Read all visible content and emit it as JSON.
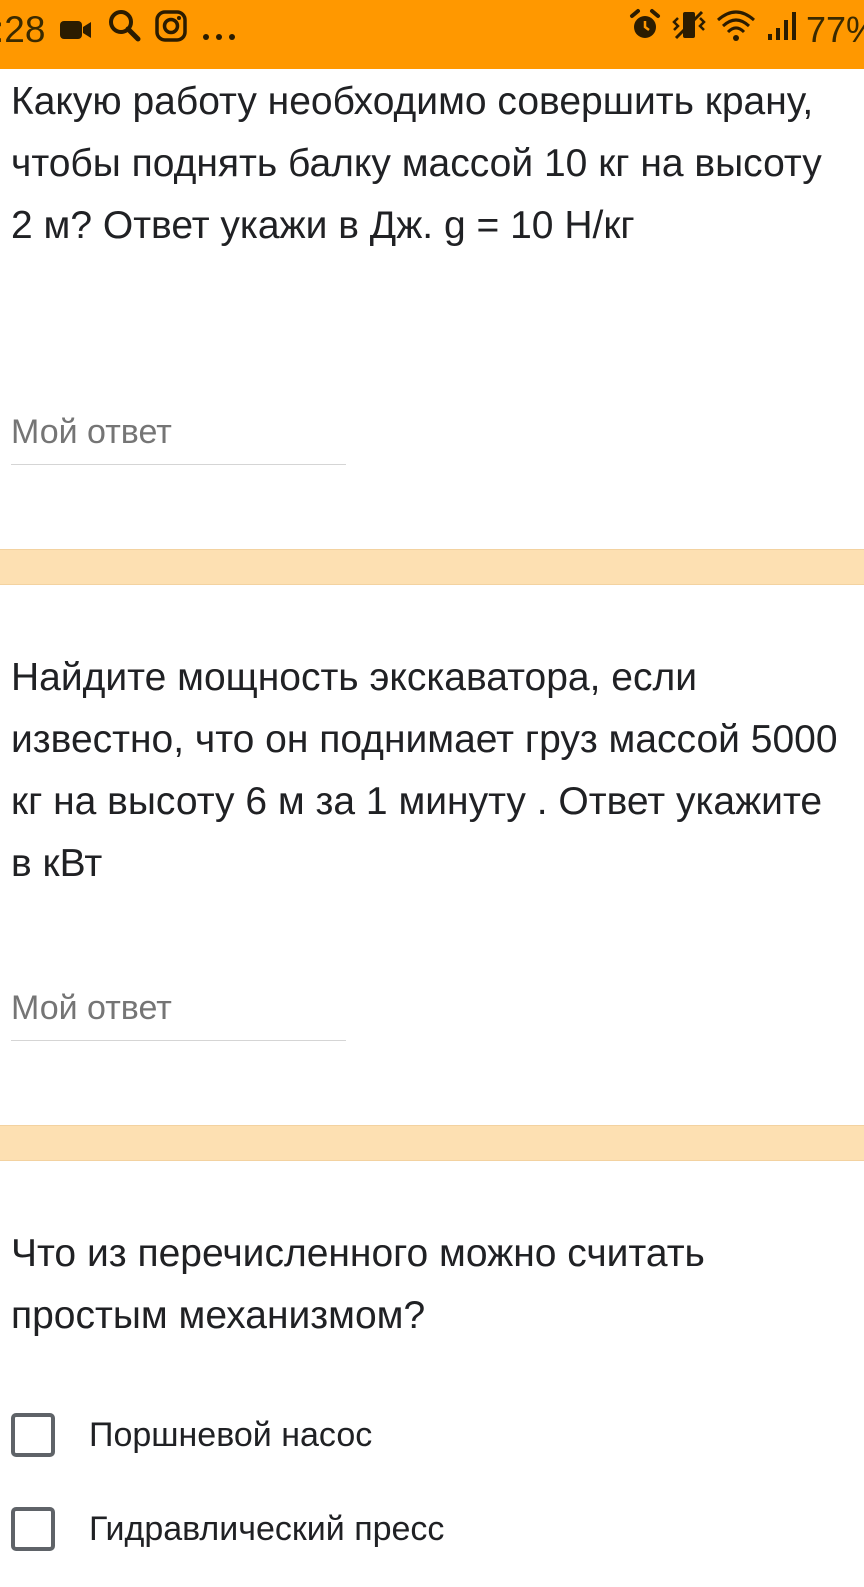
{
  "status_bar": {
    "time": ":28",
    "battery": "77%",
    "background_color": "#ff9800",
    "left_icons": [
      "video-icon",
      "search-icon",
      "instagram-icon",
      "more-icon"
    ],
    "right_icons": [
      "alarm-icon",
      "vibrate-icon",
      "wifi-icon",
      "signal-icon"
    ]
  },
  "questions": [
    {
      "text": "Какую работу необходимо совершить крану, чтобы поднять балку массой 10 кг на высоту 2 м? Ответ укажи в Дж. g = 10 Н/кг",
      "answer_placeholder": "Мой ответ",
      "answer_value": ""
    },
    {
      "text": "Найдите мощность экскаватора, если известно, что он поднимает груз массой 5000 кг на высоту 6 м за 1 минуту . Ответ укажите в кВт",
      "answer_placeholder": "Мой ответ",
      "answer_value": ""
    },
    {
      "text": "Что из перечисленного можно считать простым механизмом?",
      "options": [
        {
          "label": "Поршневой насос",
          "checked": false
        },
        {
          "label": "Гидравлический пресс",
          "checked": false
        }
      ]
    }
  ],
  "colors": {
    "divider": "#fde0b2",
    "text": "#202124",
    "placeholder": "#757575"
  }
}
